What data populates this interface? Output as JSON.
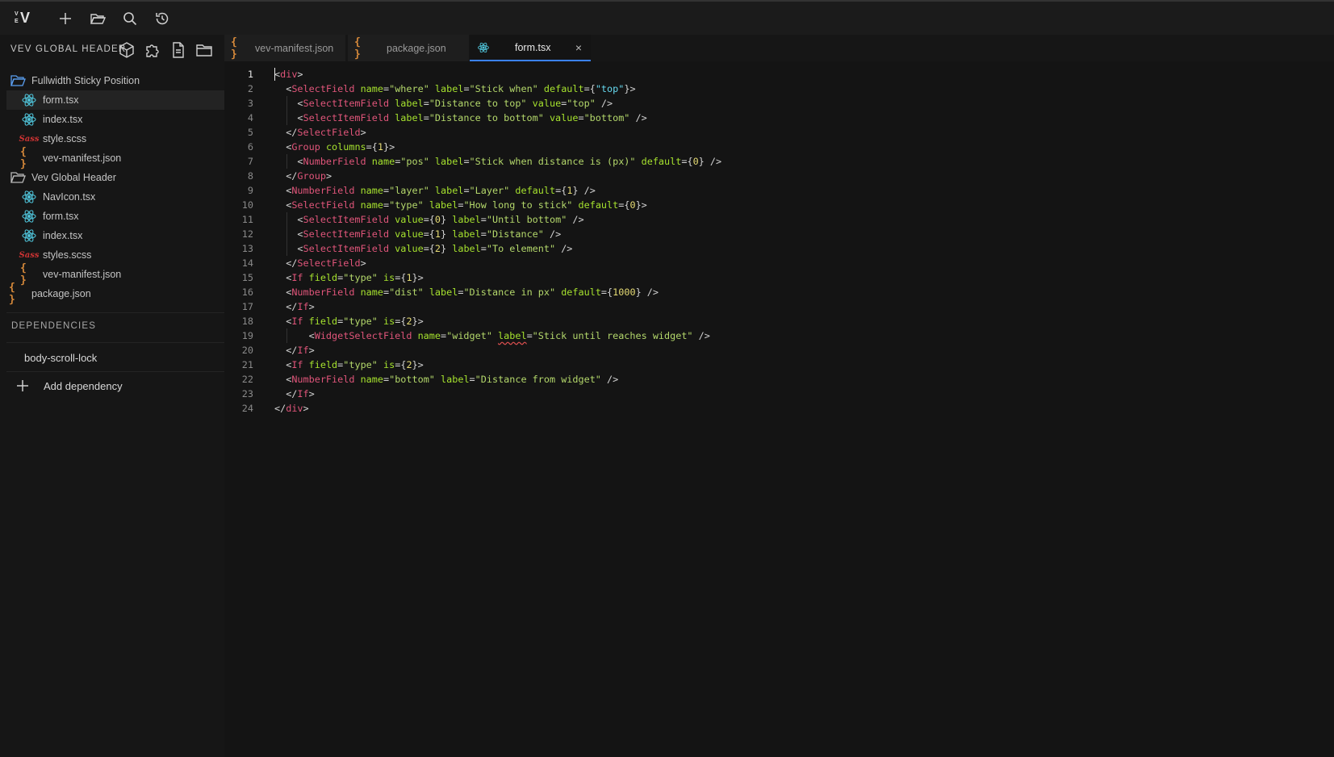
{
  "app": {
    "logo_top": "V",
    "logo_main": "V",
    "logo_sub": "E"
  },
  "topbar": {
    "icons": [
      "plus-icon",
      "folder-open-icon",
      "search-icon",
      "history-icon"
    ]
  },
  "sidebar": {
    "title": "VEV GLOBAL HEADER",
    "header_icons": [
      "cube-icon",
      "puzzle-icon",
      "file-icon",
      "folder-icon"
    ],
    "items": [
      {
        "label": "Fullwidth Sticky Position",
        "icon": "folder-open-icon",
        "depth": 0
      },
      {
        "label": "form.tsx",
        "icon": "react-icon",
        "depth": 1,
        "active": true
      },
      {
        "label": "index.tsx",
        "icon": "react-icon",
        "depth": 1
      },
      {
        "label": "style.scss",
        "icon": "sass-icon",
        "depth": 1
      },
      {
        "label": "vev-manifest.json",
        "icon": "json-icon",
        "depth": 1
      },
      {
        "label": "Vev Global Header",
        "icon": "folder-icon",
        "depth": 0
      },
      {
        "label": "NavIcon.tsx",
        "icon": "react-icon",
        "depth": 1
      },
      {
        "label": "form.tsx",
        "icon": "react-icon",
        "depth": 1
      },
      {
        "label": "index.tsx",
        "icon": "react-icon",
        "depth": 1
      },
      {
        "label": "styles.scss",
        "icon": "sass-icon",
        "depth": 1
      },
      {
        "label": "vev-manifest.json",
        "icon": "json-icon",
        "depth": 1
      },
      {
        "label": "package.json",
        "icon": "json-icon",
        "depth": 0
      }
    ],
    "dependencies_title": "DEPENDENCIES",
    "dependencies": [
      "body-scroll-lock"
    ],
    "add_dependency": "Add dependency"
  },
  "tabs": [
    {
      "label": "vev-manifest.json",
      "icon": "json-icon",
      "active": false
    },
    {
      "label": "package.json",
      "icon": "json-icon",
      "active": false
    },
    {
      "label": "form.tsx",
      "icon": "react-icon",
      "active": true,
      "close": "×"
    }
  ],
  "editor": {
    "current_line": 1,
    "lines": [
      [
        [
          "punc",
          "<"
        ],
        [
          "tag",
          "div"
        ],
        [
          "punc",
          ">"
        ]
      ],
      [
        [
          "punc",
          "  <"
        ],
        [
          "tag",
          "SelectField"
        ],
        [
          "punc",
          " "
        ],
        [
          "attr",
          "name"
        ],
        [
          "punc",
          "="
        ],
        [
          "str",
          "\"where\""
        ],
        [
          "punc",
          " "
        ],
        [
          "attr",
          "label"
        ],
        [
          "punc",
          "="
        ],
        [
          "str",
          "\"Stick when\""
        ],
        [
          "punc",
          " "
        ],
        [
          "attr",
          "default"
        ],
        [
          "punc",
          "={"
        ],
        [
          "jsx-s",
          "\"top\""
        ],
        [
          "punc",
          "}>"
        ]
      ],
      [
        [
          "punc",
          "    <"
        ],
        [
          "tag",
          "SelectItemField"
        ],
        [
          "punc",
          " "
        ],
        [
          "attr",
          "label"
        ],
        [
          "punc",
          "="
        ],
        [
          "str",
          "\"Distance to top\""
        ],
        [
          "punc",
          " "
        ],
        [
          "attr",
          "value"
        ],
        [
          "punc",
          "="
        ],
        [
          "str",
          "\"top\""
        ],
        [
          "punc",
          " />"
        ]
      ],
      [
        [
          "punc",
          "    <"
        ],
        [
          "tag",
          "SelectItemField"
        ],
        [
          "punc",
          " "
        ],
        [
          "attr",
          "label"
        ],
        [
          "punc",
          "="
        ],
        [
          "str",
          "\"Distance to bottom\""
        ],
        [
          "punc",
          " "
        ],
        [
          "attr",
          "value"
        ],
        [
          "punc",
          "="
        ],
        [
          "str",
          "\"bottom\""
        ],
        [
          "punc",
          " />"
        ]
      ],
      [
        [
          "punc",
          "  </"
        ],
        [
          "tag",
          "SelectField"
        ],
        [
          "punc",
          ">"
        ]
      ],
      [
        [
          "punc",
          "  <"
        ],
        [
          "tag",
          "Group"
        ],
        [
          "punc",
          " "
        ],
        [
          "attr",
          "columns"
        ],
        [
          "punc",
          "={"
        ],
        [
          "num",
          "1"
        ],
        [
          "punc",
          "}>"
        ]
      ],
      [
        [
          "punc",
          "    <"
        ],
        [
          "tag",
          "NumberField"
        ],
        [
          "punc",
          " "
        ],
        [
          "attr",
          "name"
        ],
        [
          "punc",
          "="
        ],
        [
          "str",
          "\"pos\""
        ],
        [
          "punc",
          " "
        ],
        [
          "attr",
          "label"
        ],
        [
          "punc",
          "="
        ],
        [
          "str",
          "\"Stick when distance is (px)\""
        ],
        [
          "punc",
          " "
        ],
        [
          "attr",
          "default"
        ],
        [
          "punc",
          "={"
        ],
        [
          "num",
          "0"
        ],
        [
          "punc",
          "} />"
        ]
      ],
      [
        [
          "punc",
          "  </"
        ],
        [
          "tag",
          "Group"
        ],
        [
          "punc",
          ">"
        ]
      ],
      [
        [
          "punc",
          "  <"
        ],
        [
          "tag",
          "NumberField"
        ],
        [
          "punc",
          " "
        ],
        [
          "attr",
          "name"
        ],
        [
          "punc",
          "="
        ],
        [
          "str",
          "\"layer\""
        ],
        [
          "punc",
          " "
        ],
        [
          "attr",
          "label"
        ],
        [
          "punc",
          "="
        ],
        [
          "str",
          "\"Layer\""
        ],
        [
          "punc",
          " "
        ],
        [
          "attr",
          "default"
        ],
        [
          "punc",
          "={"
        ],
        [
          "num",
          "1"
        ],
        [
          "punc",
          "} />"
        ]
      ],
      [
        [
          "punc",
          "  <"
        ],
        [
          "tag",
          "SelectField"
        ],
        [
          "punc",
          " "
        ],
        [
          "attr",
          "name"
        ],
        [
          "punc",
          "="
        ],
        [
          "str",
          "\"type\""
        ],
        [
          "punc",
          " "
        ],
        [
          "attr",
          "label"
        ],
        [
          "punc",
          "="
        ],
        [
          "str",
          "\"How long to stick\""
        ],
        [
          "punc",
          " "
        ],
        [
          "attr",
          "default"
        ],
        [
          "punc",
          "={"
        ],
        [
          "num",
          "0"
        ],
        [
          "punc",
          "}>"
        ]
      ],
      [
        [
          "punc",
          "    <"
        ],
        [
          "tag",
          "SelectItemField"
        ],
        [
          "punc",
          " "
        ],
        [
          "attr",
          "value"
        ],
        [
          "punc",
          "={"
        ],
        [
          "num",
          "0"
        ],
        [
          "punc",
          "} "
        ],
        [
          "attr",
          "label"
        ],
        [
          "punc",
          "="
        ],
        [
          "str",
          "\"Until bottom\""
        ],
        [
          "punc",
          " />"
        ]
      ],
      [
        [
          "punc",
          "    <"
        ],
        [
          "tag",
          "SelectItemField"
        ],
        [
          "punc",
          " "
        ],
        [
          "attr",
          "value"
        ],
        [
          "punc",
          "={"
        ],
        [
          "num",
          "1"
        ],
        [
          "punc",
          "} "
        ],
        [
          "attr",
          "label"
        ],
        [
          "punc",
          "="
        ],
        [
          "str",
          "\"Distance\""
        ],
        [
          "punc",
          " />"
        ]
      ],
      [
        [
          "punc",
          "    <"
        ],
        [
          "tag",
          "SelectItemField"
        ],
        [
          "punc",
          " "
        ],
        [
          "attr",
          "value"
        ],
        [
          "punc",
          "={"
        ],
        [
          "num",
          "2"
        ],
        [
          "punc",
          "} "
        ],
        [
          "attr",
          "label"
        ],
        [
          "punc",
          "="
        ],
        [
          "str",
          "\"To element\""
        ],
        [
          "punc",
          " />"
        ]
      ],
      [
        [
          "punc",
          "  </"
        ],
        [
          "tag",
          "SelectField"
        ],
        [
          "punc",
          ">"
        ]
      ],
      [
        [
          "punc",
          "  <"
        ],
        [
          "tag",
          "If"
        ],
        [
          "punc",
          " "
        ],
        [
          "attr",
          "field"
        ],
        [
          "punc",
          "="
        ],
        [
          "str",
          "\"type\""
        ],
        [
          "punc",
          " "
        ],
        [
          "attr",
          "is"
        ],
        [
          "punc",
          "={"
        ],
        [
          "num",
          "1"
        ],
        [
          "punc",
          "}>"
        ]
      ],
      [
        [
          "punc",
          "  <"
        ],
        [
          "tag",
          "NumberField"
        ],
        [
          "punc",
          " "
        ],
        [
          "attr",
          "name"
        ],
        [
          "punc",
          "="
        ],
        [
          "str",
          "\"dist\""
        ],
        [
          "punc",
          " "
        ],
        [
          "attr",
          "label"
        ],
        [
          "punc",
          "="
        ],
        [
          "str",
          "\"Distance in px\""
        ],
        [
          "punc",
          " "
        ],
        [
          "attr",
          "default"
        ],
        [
          "punc",
          "={"
        ],
        [
          "num",
          "1000"
        ],
        [
          "punc",
          "} />"
        ]
      ],
      [
        [
          "punc",
          "  </"
        ],
        [
          "tag",
          "If"
        ],
        [
          "punc",
          ">"
        ]
      ],
      [
        [
          "punc",
          "  <"
        ],
        [
          "tag",
          "If"
        ],
        [
          "punc",
          " "
        ],
        [
          "attr",
          "field"
        ],
        [
          "punc",
          "="
        ],
        [
          "str",
          "\"type\""
        ],
        [
          "punc",
          " "
        ],
        [
          "attr",
          "is"
        ],
        [
          "punc",
          "={"
        ],
        [
          "num",
          "2"
        ],
        [
          "punc",
          "}>"
        ]
      ],
      [
        [
          "punc",
          "      <"
        ],
        [
          "tag",
          "WidgetSelectField"
        ],
        [
          "punc",
          " "
        ],
        [
          "attr",
          "name"
        ],
        [
          "punc",
          "="
        ],
        [
          "str",
          "\"widget\""
        ],
        [
          "punc",
          " "
        ],
        [
          "attr-sq",
          "label"
        ],
        [
          "punc",
          "="
        ],
        [
          "str",
          "\"Stick until reaches widget\""
        ],
        [
          "punc",
          " />"
        ]
      ],
      [
        [
          "punc",
          "  </"
        ],
        [
          "tag",
          "If"
        ],
        [
          "punc",
          ">"
        ]
      ],
      [
        [
          "punc",
          "  <"
        ],
        [
          "tag",
          "If"
        ],
        [
          "punc",
          " "
        ],
        [
          "attr",
          "field"
        ],
        [
          "punc",
          "="
        ],
        [
          "str",
          "\"type\""
        ],
        [
          "punc",
          " "
        ],
        [
          "attr",
          "is"
        ],
        [
          "punc",
          "={"
        ],
        [
          "num",
          "2"
        ],
        [
          "punc",
          "}>"
        ]
      ],
      [
        [
          "punc",
          "  <"
        ],
        [
          "tag",
          "NumberField"
        ],
        [
          "punc",
          " "
        ],
        [
          "attr",
          "name"
        ],
        [
          "punc",
          "="
        ],
        [
          "str",
          "\"bottom\""
        ],
        [
          "punc",
          " "
        ],
        [
          "attr",
          "label"
        ],
        [
          "punc",
          "="
        ],
        [
          "str",
          "\"Distance from widget\""
        ],
        [
          "punc",
          " />"
        ]
      ],
      [
        [
          "punc",
          "  </"
        ],
        [
          "tag",
          "If"
        ],
        [
          "punc",
          ">"
        ]
      ],
      [
        [
          "punc",
          "</"
        ],
        [
          "tag",
          "div"
        ],
        [
          "punc",
          ">"
        ]
      ]
    ]
  }
}
